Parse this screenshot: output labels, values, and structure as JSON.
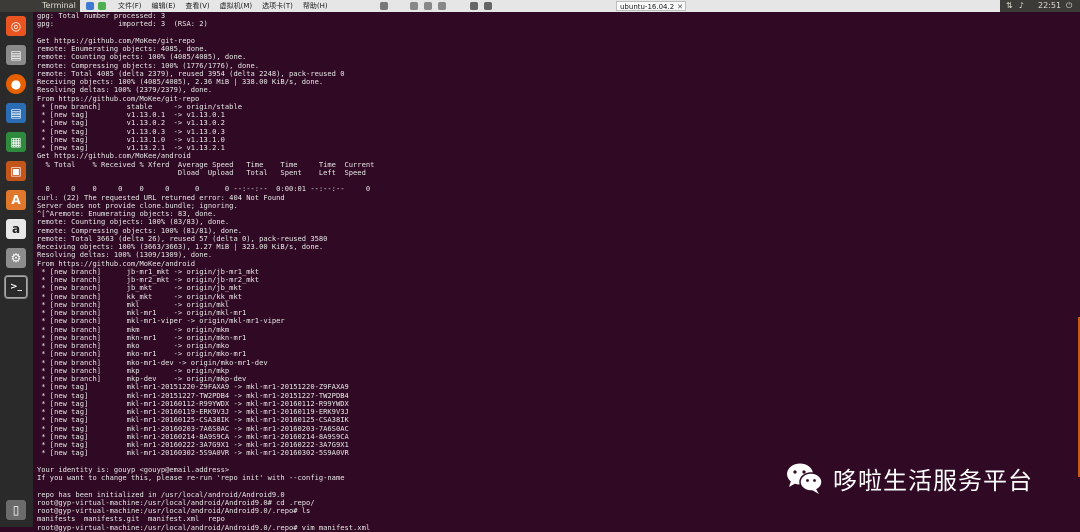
{
  "topbar": {
    "app_title": "Terminal",
    "menus": [
      "文件(F)",
      "编辑(E)",
      "查看(V)",
      "虚拟机(M)",
      "选项卡(T)",
      "帮助(H)"
    ],
    "vm_tab": "ubuntu-16.04.2",
    "clock": "22:51"
  },
  "launcher": {
    "items": [
      {
        "name": "ubuntu-dash-icon",
        "color": "#e95420",
        "glyph": "◎"
      },
      {
        "name": "files-icon",
        "color": "#8a8a8a",
        "glyph": "▤"
      },
      {
        "name": "firefox-icon",
        "color": "#e66000",
        "glyph": "●"
      },
      {
        "name": "writer-icon",
        "color": "#2a6db5",
        "glyph": "▤"
      },
      {
        "name": "calc-icon",
        "color": "#2e8b3d",
        "glyph": "▦"
      },
      {
        "name": "impress-icon",
        "color": "#c4561c",
        "glyph": "▣"
      },
      {
        "name": "software-center-icon",
        "color": "#e0772a",
        "glyph": "A"
      },
      {
        "name": "amazon-icon",
        "color": "#e8e8e8",
        "glyph": "a"
      },
      {
        "name": "settings-icon",
        "color": "#8c8c8c",
        "glyph": "⚙"
      },
      {
        "name": "terminal-icon",
        "color": "#2b2b2b",
        "glyph": ">_"
      },
      {
        "name": "trash-icon",
        "color": "#6b6b6b",
        "glyph": "▯"
      }
    ]
  },
  "terminal": {
    "lines": [
      "gpg: Total number processed: 3",
      "gpg:               imported: 3  (RSA: 2)",
      "",
      "Get https://github.com/MoKee/git-repo",
      "remote: Enumerating objects: 4085, done.",
      "remote: Counting objects: 100% (4085/4085), done.",
      "remote: Compressing objects: 100% (1776/1776), done.",
      "remote: Total 4085 (delta 2379), reused 3954 (delta 2248), pack-reused 0",
      "Receiving objects: 100% (4085/4085), 2.36 MiB | 338.00 KiB/s, done.",
      "Resolving deltas: 100% (2379/2379), done.",
      "From https://github.com/MoKee/git-repo",
      " * [new branch]      stable     -> origin/stable",
      " * [new tag]         v1.13.0.1  -> v1.13.0.1",
      " * [new tag]         v1.13.0.2  -> v1.13.0.2",
      " * [new tag]         v1.13.0.3  -> v1.13.0.3",
      " * [new tag]         v1.13.1.0  -> v1.13.1.0",
      " * [new tag]         v1.13.2.1  -> v1.13.2.1",
      "Get https://github.com/MoKee/android",
      "  % Total    % Received % Xferd  Average Speed   Time    Time     Time  Current",
      "                                 Dload  Upload   Total   Spent    Left  Speed",
      "",
      "  0     0    0     0    0     0      0      0 --:--:--  0:00:01 --:--:--     0",
      "curl: (22) The requested URL returned error: 404 Not Found",
      "Server does not provide clone.bundle; ignoring.",
      "^[^Aremote: Enumerating objects: 83, done.",
      "remote: Counting objects: 100% (83/83), done.",
      "remote: Compressing objects: 100% (81/81), done.",
      "remote: Total 3663 (delta 26), reused 57 (delta 0), pack-reused 3580",
      "Receiving objects: 100% (3663/3663), 1.27 MiB | 323.00 KiB/s, done.",
      "Resolving deltas: 100% (1309/1309), done.",
      "From https://github.com/MoKee/android",
      " * [new branch]      jb-mr1_mkt -> origin/jb-mr1_mkt",
      " * [new branch]      jb-mr2_mkt -> origin/jb-mr2_mkt",
      " * [new branch]      jb_mkt     -> origin/jb_mkt",
      " * [new branch]      kk_mkt     -> origin/kk_mkt",
      " * [new branch]      mkl        -> origin/mkl",
      " * [new branch]      mkl-mr1    -> origin/mkl-mr1",
      " * [new branch]      mkl-mr1-viper -> origin/mkl-mr1-viper",
      " * [new branch]      mkm        -> origin/mkm",
      " * [new branch]      mkn-mr1    -> origin/mkn-mr1",
      " * [new branch]      mko        -> origin/mko",
      " * [new branch]      mko-mr1    -> origin/mko-mr1",
      " * [new branch]      mko-mr1-dev -> origin/mko-mr1-dev",
      " * [new branch]      mkp        -> origin/mkp",
      " * [new branch]      mkp-dev    -> origin/mkp-dev",
      " * [new tag]         mkl-mr1-20151220-Z9FAXA9 -> mkl-mr1-20151220-Z9FAXA9",
      " * [new tag]         mkl-mr1-20151227-TW2PDB4 -> mkl-mr1-20151227-TW2PDB4",
      " * [new tag]         mkl-mr1-20160112-R99YWDX -> mkl-mr1-20160112-R99YWDX",
      " * [new tag]         mkl-mr1-20160119-ERK9V3J -> mkl-mr1-20160119-ERK9V3J",
      " * [new tag]         mkl-mr1-20160125-CSA38IK -> mkl-mr1-20160125-CSA38IK",
      " * [new tag]         mkl-mr1-20160203-7A6S0AC -> mkl-mr1-20160203-7A6S0AC",
      " * [new tag]         mkl-mr1-20160214-8A9S9CA -> mkl-mr1-20160214-8A9S9CA",
      " * [new tag]         mkl-mr1-20160222-3A7G9X1 -> mkl-mr1-20160222-3A7G9X1",
      " * [new tag]         mkl-mr1-20160302-5S9A0VR -> mkl-mr1-20160302-5S9A0VR",
      "",
      "Your identity is: gouyp <gouyp@email.address>",
      "If you want to change this, please re-run 'repo init' with --config-name",
      "",
      "repo has been initialized in /usr/local/android/Android9.0",
      "root@gyp-virtual-machine:/usr/local/android/Android9.0# cd .repo/",
      "root@gyp-virtual-machine:/usr/local/android/Android9.0/.repo# ls",
      "manifests  manifests.git  manifest.xml  repo",
      "root@gyp-virtual-machine:/usr/local/android/Android9.0/.repo# vim manifest.xml"
    ]
  },
  "watermark": {
    "text": "哆啦生活服务平台",
    "icon_name": "wechat-icon"
  }
}
